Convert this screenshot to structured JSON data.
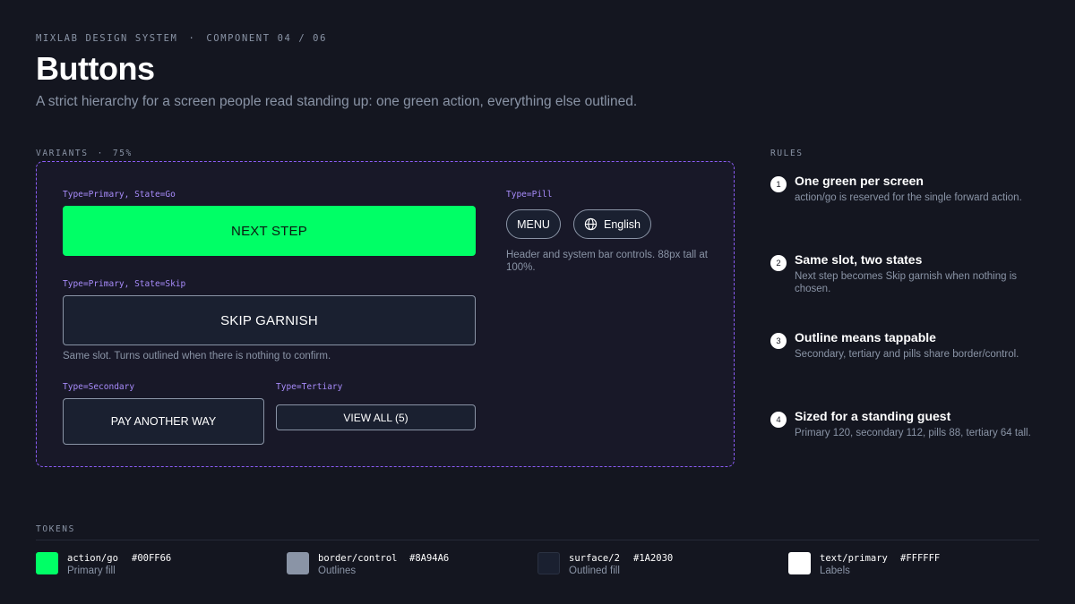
{
  "header": {
    "brand": "MIXLAB DESIGN SYSTEM",
    "separator": "·",
    "component": "COMPONENT 04 / 06",
    "title": "Buttons",
    "subtitle": "A strict hierarchy for a screen people read standing up: one green action, everything else outlined."
  },
  "variants": {
    "label": "VARIANTS",
    "separator": "·",
    "zoom": "75%",
    "primary_go": {
      "label": "Type=Primary, State=Go",
      "button": "NEXT STEP"
    },
    "primary_skip": {
      "label": "Type=Primary, State=Skip",
      "button": "SKIP GARNISH",
      "note": "Same slot. Turns outlined when there is nothing to confirm."
    },
    "secondary": {
      "label": "Type=Secondary",
      "button": "PAY ANOTHER WAY"
    },
    "tertiary": {
      "label": "Type=Tertiary",
      "button": "VIEW ALL (5)"
    },
    "pill": {
      "label": "Type=Pill",
      "menu": "MENU",
      "language": "English",
      "note": "Header and system bar controls. 88px tall at 100%."
    }
  },
  "rules": {
    "label": "RULES",
    "items": [
      {
        "num": "1",
        "title": "One green per screen",
        "desc": "action/go is reserved for the single forward action."
      },
      {
        "num": "2",
        "title": "Same slot, two states",
        "desc": "Next step becomes Skip garnish when nothing is chosen."
      },
      {
        "num": "3",
        "title": "Outline means tappable",
        "desc": "Secondary, tertiary and pills share border/control."
      },
      {
        "num": "4",
        "title": "Sized for a standing guest",
        "desc": "Primary 120, secondary 112, pills 88, tertiary 64 tall."
      }
    ]
  },
  "tokens": {
    "label": "TOKENS",
    "items": [
      {
        "name": "action/go",
        "hex": "#00FF66",
        "desc": "Primary fill",
        "color": "#00FF66"
      },
      {
        "name": "border/control",
        "hex": "#8A94A6",
        "desc": "Outlines",
        "color": "#8A94A6"
      },
      {
        "name": "surface/2",
        "hex": "#1A2030",
        "desc": "Outlined fill",
        "color": "#1A2030"
      },
      {
        "name": "text/primary",
        "hex": "#FFFFFF",
        "desc": "Labels",
        "color": "#FFFFFF"
      }
    ]
  },
  "icons": {
    "language": "globe-icon"
  }
}
